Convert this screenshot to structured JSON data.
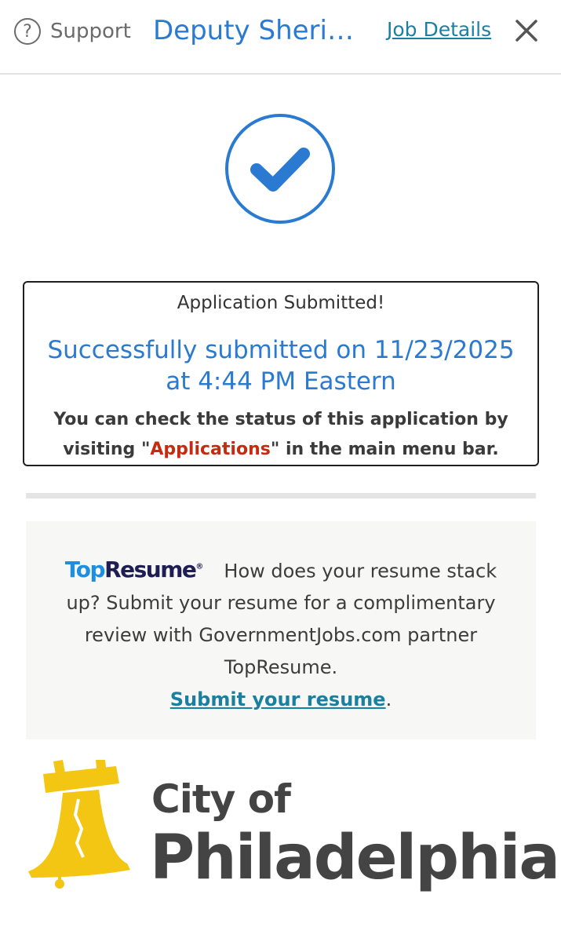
{
  "header": {
    "support_label": "Support",
    "job_title": "Deputy Sheriff ...",
    "job_details_label": "Job Details"
  },
  "confirmation": {
    "heading": "Application Submitted!",
    "submitted_message": "Successfully submitted on 11/23/2025 at 4:44 PM Eastern",
    "status_note_before": "You can check the status of this application by visiting \"",
    "status_note_link": "Applications",
    "status_note_after": "\" in the main menu bar."
  },
  "promo": {
    "brand_part1": "Top",
    "brand_part2": "Resume",
    "brand_mark": "®",
    "text": "How does your resume stack up? Submit your resume for a complimentary review with GovernmentJobs.com partner TopResume.",
    "link_label": "Submit your resume",
    "link_suffix": "."
  },
  "footer_logo": {
    "line1": "City of",
    "line2": "Philadelphia"
  },
  "colors": {
    "accent_blue": "#2a7ad2",
    "link_teal": "#1a7fa0",
    "applications_red": "#c52b10",
    "bell_yellow": "#f3c613"
  },
  "icons": {
    "support": "question-circle-icon",
    "close": "close-icon",
    "success": "check-circle-icon",
    "city": "liberty-bell-icon"
  }
}
